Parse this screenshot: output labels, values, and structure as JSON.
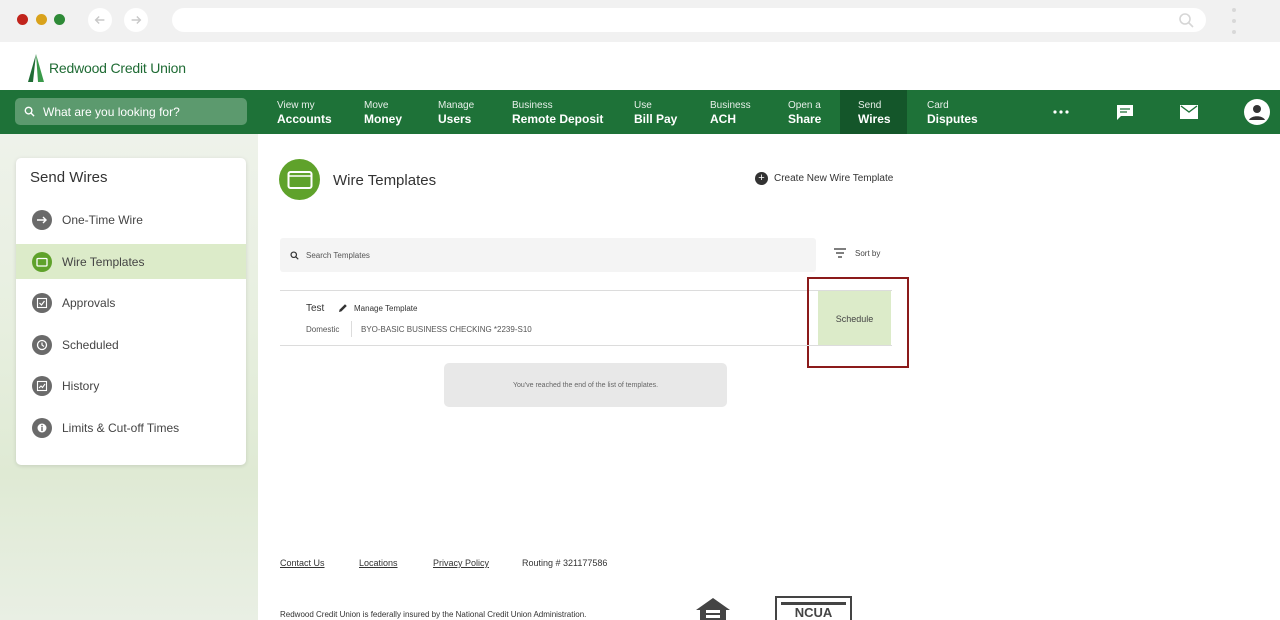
{
  "brand": {
    "name": "Redwood Credit Union",
    "color": "#1f6b34"
  },
  "colors": {
    "nav_bg": "#1e7238",
    "nav_active": "#14562a",
    "accent_green": "#5fa22b",
    "highlight_border": "#8b1a1a"
  },
  "nav": {
    "search_placeholder": "What are you looking for?",
    "items": [
      {
        "l1": "View my",
        "l2": "Accounts"
      },
      {
        "l1": "Move",
        "l2": "Money"
      },
      {
        "l1": "Manage",
        "l2": "Users"
      },
      {
        "l1": "Business",
        "l2": "Remote Deposit"
      },
      {
        "l1": "Use",
        "l2": "Bill Pay"
      },
      {
        "l1": "Business",
        "l2": "ACH"
      },
      {
        "l1": "Open a",
        "l2": "Share"
      },
      {
        "l1": "Send",
        "l2": "Wires"
      },
      {
        "l1": "Card",
        "l2": "Disputes"
      }
    ],
    "active": "Send Wires",
    "icons": [
      "more-icon",
      "chat-icon",
      "mail-icon",
      "profile-icon"
    ]
  },
  "sidebar": {
    "title": "Send Wires",
    "items": [
      {
        "label": "One-Time Wire",
        "icon": "arrow-right-icon"
      },
      {
        "label": "Wire Templates",
        "icon": "folder-icon"
      },
      {
        "label": "Approvals",
        "icon": "check-icon"
      },
      {
        "label": "Scheduled",
        "icon": "clock-icon"
      },
      {
        "label": "History",
        "icon": "history-icon"
      },
      {
        "label": "Limits & Cut-off Times",
        "icon": "info-icon"
      }
    ],
    "active": "Wire Templates"
  },
  "main": {
    "title": "Wire Templates",
    "create_label": "Create New Wire Template",
    "search_placeholder": "Search Templates",
    "sort_label": "Sort by",
    "templates": [
      {
        "name": "Test",
        "manage_label": "Manage Template",
        "type": "Domestic",
        "account": "BYO-BASIC BUSINESS CHECKING *2239-S10",
        "action": "Schedule"
      }
    ],
    "end_message": "You've reached the end of the list of templates."
  },
  "footer": {
    "links": [
      "Contact Us",
      "Locations",
      "Privacy Policy"
    ],
    "routing": "Routing # 321177586",
    "disclaimer": "Redwood Credit Union is federally insured by the National Credit Union Administration.",
    "ncua_label": "NCUA"
  }
}
